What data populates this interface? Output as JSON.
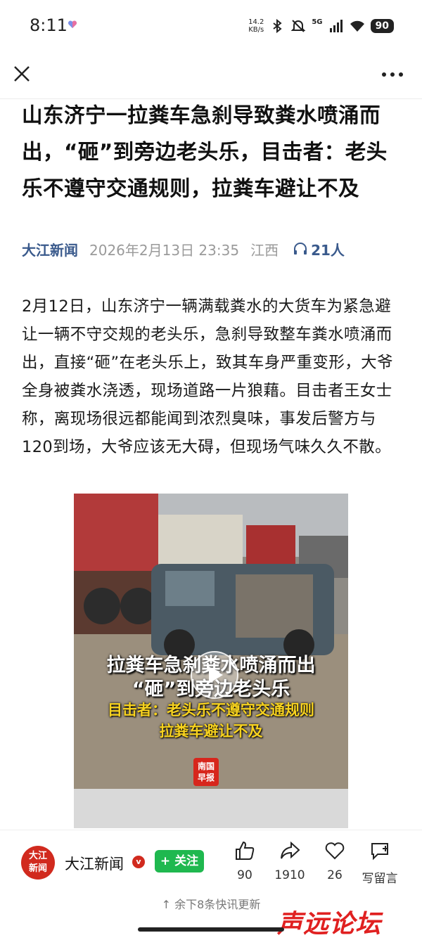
{
  "status_bar": {
    "time": "8:11",
    "net_speed_value": "14.2",
    "net_speed_unit": "KB/s",
    "network": "5G",
    "battery": "90"
  },
  "article": {
    "title": "山东济宁一拉粪车急刹导致粪水喷涌而出，“砸”到旁边老头乐，目击者：老头乐不遵守交通规则，拉粪车避让不及",
    "source": "大江新闻",
    "date": "2026年2月13日 23:35",
    "region": "江西",
    "listeners": "21人",
    "body": "2月12日，山东济宁一辆满载粪水的大货车为紧急避让一辆不守交规的老头乐，急刹导致整车粪水喷涌而出，直接“砸”在老头乐上，致其车身严重变形，大爷全身被粪水浇透，现场道路一片狼藉。目击者王女士称，离现场很远都能闻到浓烈臭味，事发后警方与120到场，大爷应该无大碍，但现场气味久久不散。"
  },
  "video": {
    "caption_line1": "拉粪车急刹粪水喷涌而出",
    "caption_line2": "“砸”到旁边老头乐",
    "caption_line3": "目击者：老头乐不遵守交通规则",
    "caption_line4": "拉粪车避让不及",
    "logo_text_1": "南国",
    "logo_text_2": "早报"
  },
  "footer": {
    "avatar_text_1": "大江",
    "avatar_text_2": "新闻",
    "account_name": "大江新闻",
    "verified_mark": "v",
    "follow_label": "+ 关注",
    "likes": "90",
    "shares": "1910",
    "favorites": "26",
    "comment_label": "写留言",
    "remaining_news": "↑ 余下8条快讯更新",
    "watermark": "声远论坛"
  },
  "colors": {
    "source_blue": "#3a5a8c",
    "follow_green": "#1fb84f",
    "brand_red": "#d12a1e",
    "caption_yellow": "#f7d21f"
  },
  "icons": [
    "heart-small-icon",
    "bluetooth-icon",
    "mute-icon",
    "signal-icon",
    "wifi-icon",
    "close-icon",
    "more-icon",
    "headphones-icon",
    "play-icon",
    "thumbs-up-icon",
    "share-icon",
    "heart-icon",
    "comment-icon"
  ]
}
